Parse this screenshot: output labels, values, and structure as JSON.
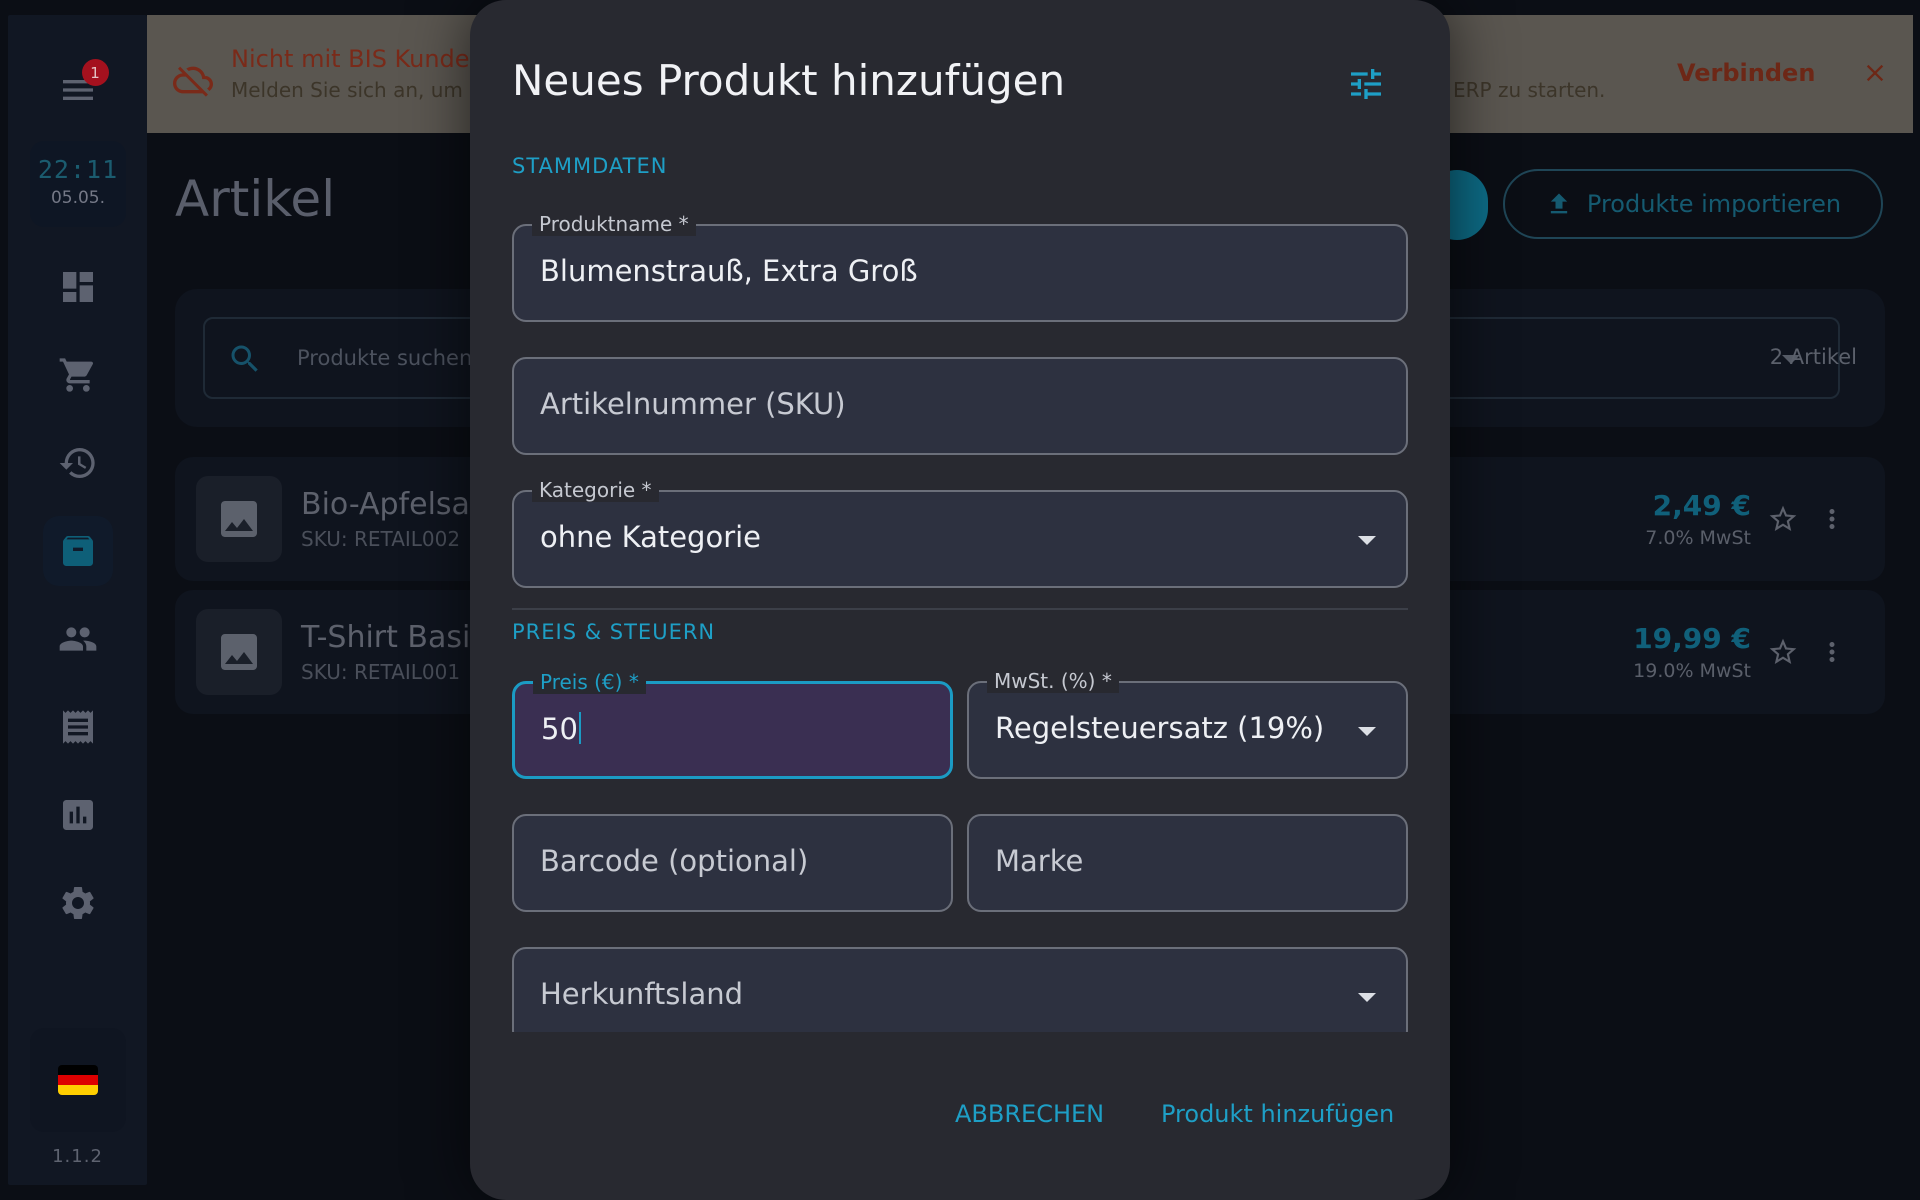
{
  "sidebar": {
    "notification_count": "1",
    "time": "22:11",
    "date": "05.05.",
    "version": "1.1.2",
    "items": [
      {
        "name": "dashboard-icon"
      },
      {
        "name": "cart-icon"
      },
      {
        "name": "history-icon"
      },
      {
        "name": "archive-icon",
        "active": true
      },
      {
        "name": "people-icon"
      },
      {
        "name": "receipt-icon"
      },
      {
        "name": "chart-icon"
      },
      {
        "name": "settings-icon"
      }
    ],
    "flag_colors": [
      "#000000",
      "#dd0000",
      "#ffce00"
    ]
  },
  "banner": {
    "title": "Nicht mit BIS Kunden",
    "subtitle": "Melden Sie sich an, um",
    "subtitle_end": "ERP zu starten.",
    "connect_label": "Verbinden"
  },
  "page": {
    "title": "Artikel",
    "import_label": "Produkte importieren",
    "search_placeholder": "Produkte suchen",
    "count_label": "2 Artikel",
    "products": [
      {
        "name": "Bio-Apfelsa",
        "sku": "SKU: RETAIL002",
        "price": "2,49 €",
        "tax": "7.0% MwSt"
      },
      {
        "name": "T-Shirt Basi",
        "sku": "SKU: RETAIL001",
        "price": "19,99 €",
        "tax": "19.0% MwSt"
      }
    ]
  },
  "modal": {
    "title": "Neues Produkt hinzufügen",
    "section_master": "STAMMDATEN",
    "section_price": "PREIS & STEUERN",
    "fields": {
      "product_name_label": "Produktname *",
      "product_name_value": "Blumenstrauß, Extra Groß",
      "sku_placeholder": "Artikelnummer (SKU)",
      "category_label": "Kategorie *",
      "category_value": "ohne Kategorie",
      "price_label": "Preis (€) *",
      "price_value": "50",
      "vat_label": "MwSt. (%) *",
      "vat_value": "Regelsteuersatz (19%)",
      "barcode_placeholder": "Barcode (optional)",
      "brand_placeholder": "Marke",
      "origin_placeholder": "Herkunftsland"
    },
    "cancel_label": "ABBRECHEN",
    "submit_label": "Produkt hinzufügen"
  },
  "colors": {
    "accent": "#1e9fc6",
    "banner_bg": "#5a5650",
    "modal_bg": "#282930",
    "focused_field_bg": "#3a2f52"
  }
}
